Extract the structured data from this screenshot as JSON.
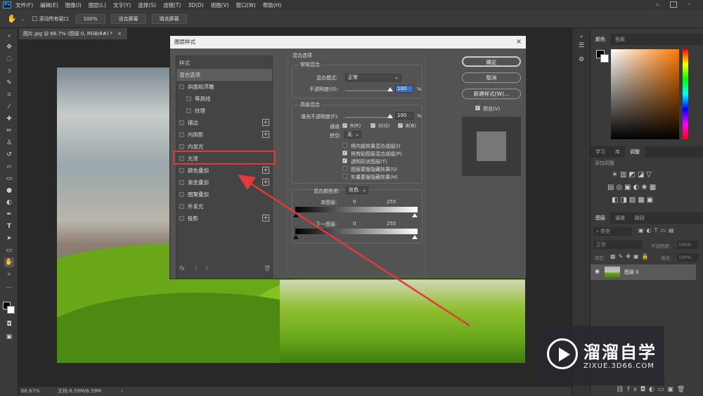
{
  "app": {
    "logo": "Ps"
  },
  "menu": [
    "文件(F)",
    "编辑(E)",
    "图像(I)",
    "图层(L)",
    "文字(Y)",
    "选择(S)",
    "滤镜(T)",
    "3D(D)",
    "视图(V)",
    "窗口(W)",
    "帮助(H)"
  ],
  "options": {
    "scroll_all": "滚动所有窗口",
    "zoom": "100%",
    "fit": "适合屏幕",
    "fill": "填充屏幕"
  },
  "doc_tab": {
    "title": "图片.jpg @ 66.7% (图层 0, RGB/8#) *",
    "close": "×"
  },
  "status": {
    "zoom": "66.67%",
    "doc": "文档:6.59M/6.59M"
  },
  "panels": {
    "color_tabs": [
      "颜色",
      "色板"
    ],
    "adjust_tabs": [
      "学习",
      "库",
      "调整"
    ],
    "add_adjust": "添加调整",
    "layers_tabs": [
      "图层",
      "通道",
      "路径"
    ],
    "kind": "类型",
    "blend": "正常",
    "opacity_label": "不透明度:",
    "opacity": "100%",
    "lock_label": "锁定:",
    "fill_label": "填充:",
    "fill": "100%",
    "layer_name": "图层 0"
  },
  "dialog": {
    "title": "图层样式",
    "close": "×",
    "styles_header": "样式",
    "styles": [
      {
        "label": "混合选项",
        "checkbox": false,
        "plus": false,
        "active": true,
        "indent": false
      },
      {
        "label": "斜面和浮雕",
        "checkbox": true,
        "plus": false,
        "active": false,
        "indent": false
      },
      {
        "label": "等高线",
        "checkbox": true,
        "plus": false,
        "active": false,
        "indent": true
      },
      {
        "label": "纹理",
        "checkbox": true,
        "plus": false,
        "active": false,
        "indent": true
      },
      {
        "label": "描边",
        "checkbox": true,
        "plus": true,
        "active": false,
        "indent": false
      },
      {
        "label": "内阴影",
        "checkbox": true,
        "plus": true,
        "active": false,
        "indent": false
      },
      {
        "label": "内发光",
        "checkbox": true,
        "plus": false,
        "active": false,
        "indent": false
      },
      {
        "label": "光泽",
        "checkbox": true,
        "plus": false,
        "active": false,
        "indent": false
      },
      {
        "label": "颜色叠加",
        "checkbox": true,
        "plus": true,
        "active": false,
        "indent": false
      },
      {
        "label": "渐变叠加",
        "checkbox": true,
        "plus": true,
        "active": false,
        "indent": false
      },
      {
        "label": "图案叠加",
        "checkbox": true,
        "plus": false,
        "active": false,
        "indent": false
      },
      {
        "label": "外发光",
        "checkbox": true,
        "plus": false,
        "active": false,
        "indent": false
      },
      {
        "label": "投影",
        "checkbox": true,
        "plus": true,
        "active": false,
        "indent": false
      }
    ],
    "fx": "fx.",
    "blend_options": "混合选项",
    "general": {
      "title": "常规混合",
      "mode_label": "混合模式:",
      "mode": "正常",
      "opacity_label": "不透明度(O):",
      "opacity": "100",
      "pct": "%"
    },
    "advanced": {
      "title": "高级混合",
      "fill_label": "填充不透明度(F):",
      "fill": "100",
      "pct": "%",
      "channels_label": "通道:",
      "channels": [
        "R(R)",
        "G(G)",
        "B(B)"
      ],
      "knockout_label": "挖空:",
      "knockout": "无",
      "options": [
        {
          "label": "将内部效果混合成组(I)",
          "checked": false
        },
        {
          "label": "将剪贴图层混合成组(P)",
          "checked": true
        },
        {
          "label": "透明形状图层(T)",
          "checked": true
        },
        {
          "label": "图层蒙版隐藏效果(S)",
          "checked": false
        },
        {
          "label": "矢量蒙版隐藏效果(H)",
          "checked": false
        }
      ]
    },
    "blendif": {
      "label": "混合颜色带:",
      "value": "灰色",
      "this_layer": "本图层:",
      "underlying": "下一图层:",
      "min": "0",
      "max": "255"
    },
    "buttons": {
      "ok": "确定",
      "cancel": "取消",
      "new_style": "新建样式(W)...",
      "preview": "预览(V)"
    }
  },
  "watermark": {
    "brand": "溜溜自学",
    "url": "ZIXUE.3D66.COM"
  },
  "colors": {
    "highlight": "#e23a3a",
    "accent": "#31a8ff"
  }
}
